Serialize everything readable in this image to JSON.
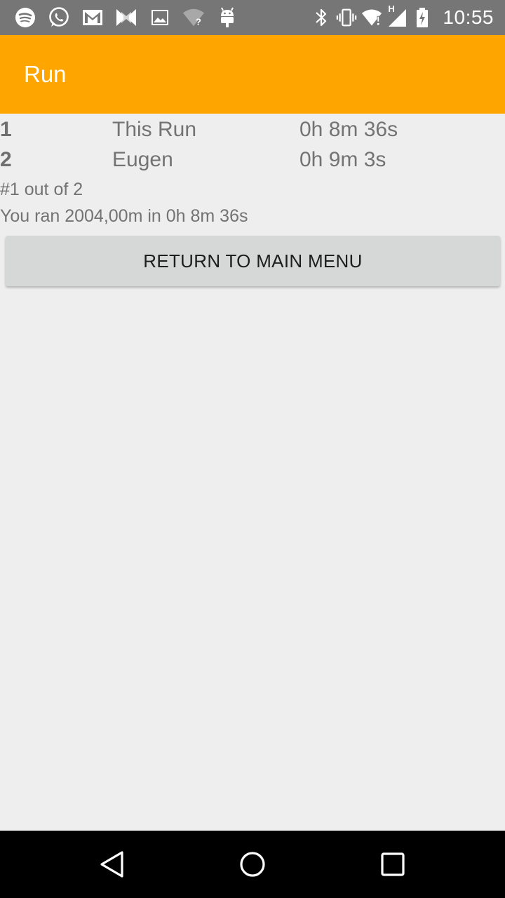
{
  "status_bar": {
    "left_icons": [
      "spotify-icon",
      "whatsapp-icon",
      "gmail-icon",
      "bowtie-icon",
      "image-icon",
      "wifi-unknown-icon",
      "android-icon"
    ],
    "right_icons": [
      "bluetooth-icon",
      "vibrate-icon",
      "wifi-alert-icon",
      "signal-icon",
      "battery-charging-icon"
    ],
    "network_label": "H",
    "time": "10:55"
  },
  "app_bar": {
    "title": "Run",
    "color": "#ffa500"
  },
  "leaderboard": [
    {
      "position": "1",
      "name": "This Run",
      "time": "0h 8m 36s"
    },
    {
      "position": "2",
      "name": "Eugen",
      "time": "0h 9m 3s"
    }
  ],
  "summary": {
    "rank_text": "#1 out of 2",
    "result_text": "You ran 2004,00m in 0h 8m 36s"
  },
  "return_button": {
    "label": "RETURN TO MAIN MENU"
  },
  "nav_bar": {
    "icons": [
      "back-icon",
      "home-icon",
      "recents-icon"
    ]
  }
}
